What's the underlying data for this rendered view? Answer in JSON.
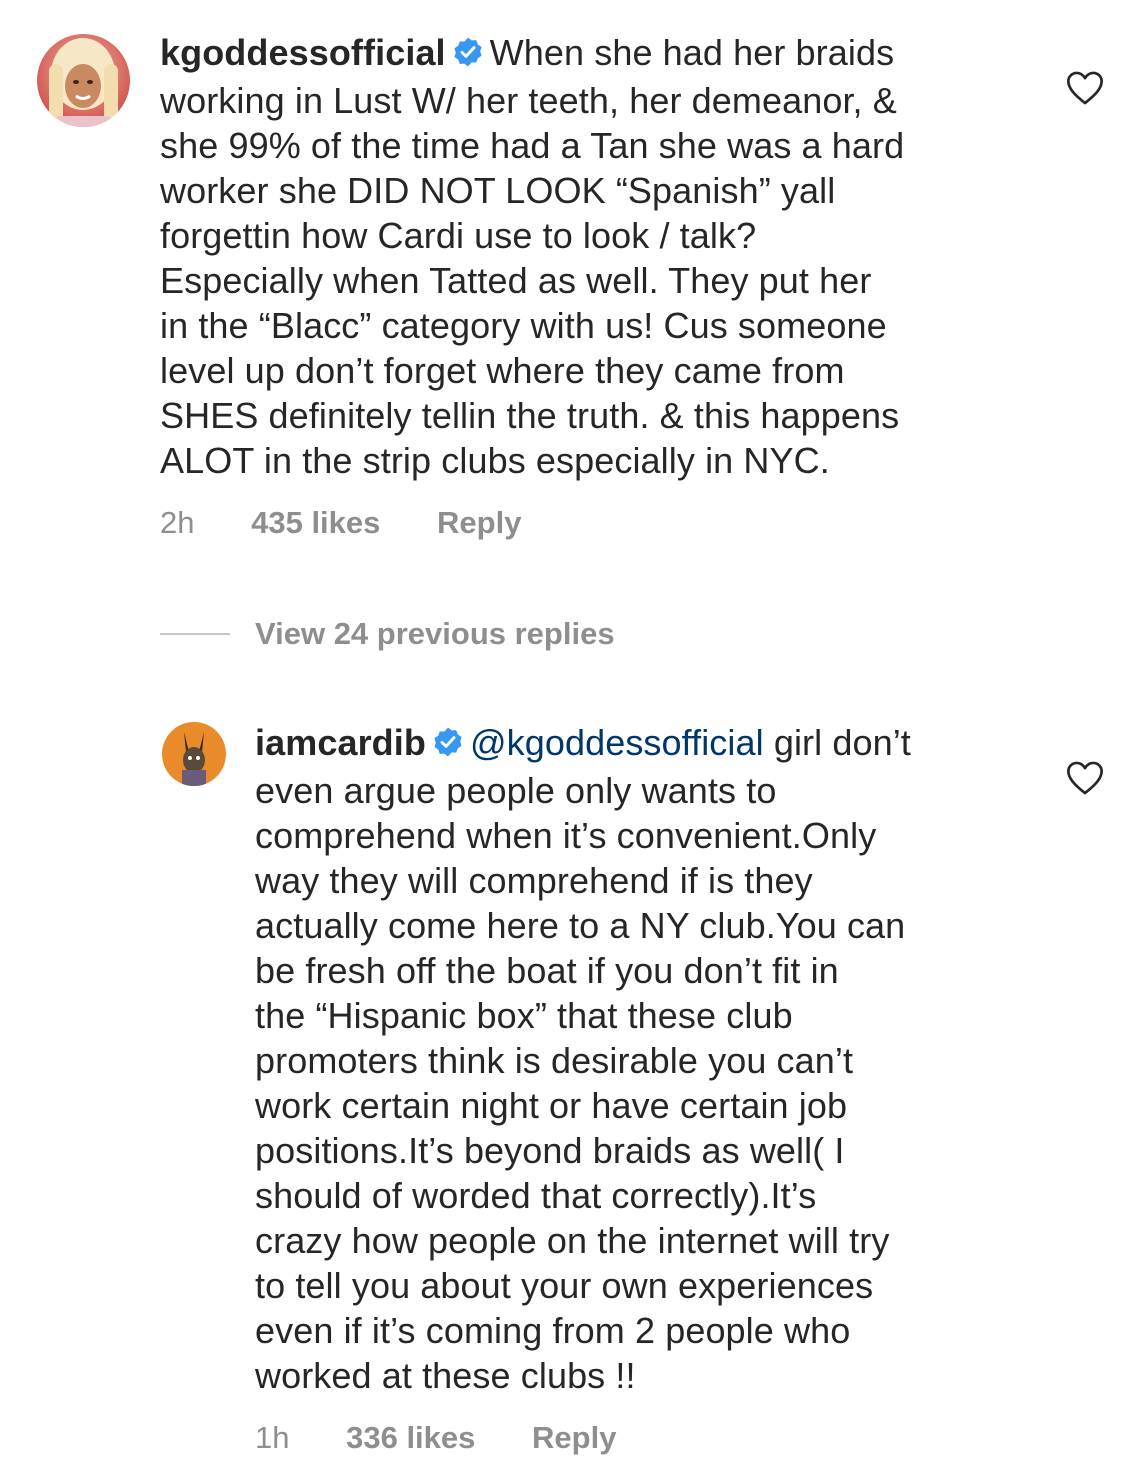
{
  "colors": {
    "text": "#262626",
    "secondary": "#8e8e8e",
    "mention": "#00376b",
    "verified": "#3897f0"
  },
  "comments": [
    {
      "username": "kgoddessofficial",
      "verified_icon": "verified-badge-icon",
      "text_lines": [
        "When she had her braids",
        "working in Lust W/ her teeth, her demeanor, &",
        "she 99% of the time had a Tan she was a hard",
        "worker she DID NOT LOOK “Spanish” yall",
        "forgettin how Cardi use to look / talk?",
        "Especially when Tatted as well. They put her",
        "in the “Blacc” category with us! Cus someone",
        "level up don’t forget where they came from",
        "SHES definitely tellin the truth. & this happens",
        "ALOT in the strip clubs especially in NYC."
      ],
      "time": "2h",
      "likes": "435 likes",
      "reply_label": "Reply"
    },
    {
      "username": "iamcardib",
      "verified_icon": "verified-badge-icon",
      "mention": "@kgoddessofficial",
      "text_lines": [
        "girl don’t",
        "even argue people only wants to",
        "comprehend when it’s convenient.Only",
        "way they will comprehend if is they",
        "actually come here to a NY club.You can",
        "be fresh off the boat if you don’t fit in",
        "the “Hispanic box” that these club",
        "promoters think is desirable you can’t",
        "work certain night or have certain job",
        "positions.It’s beyond braids as well( I",
        "should of worded that correctly).It’s",
        "crazy how people on the internet will try",
        "to tell you about your own experiences",
        "even if it’s coming from 2 people who",
        "worked at these clubs !!"
      ],
      "time": "1h",
      "likes": "336 likes",
      "reply_label": "Reply"
    }
  ],
  "view_replies": {
    "label": "View 24 previous replies"
  },
  "icons": {
    "like": "heart-outline-icon",
    "verified": "verified-badge-icon"
  }
}
